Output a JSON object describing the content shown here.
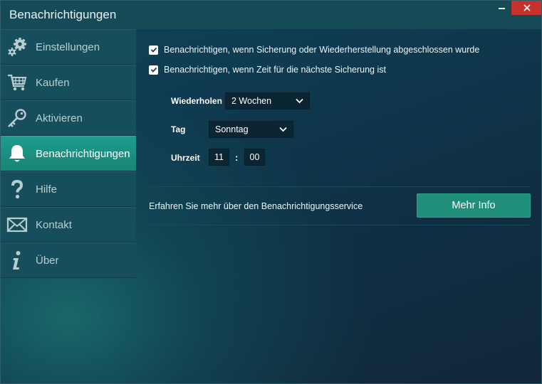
{
  "window": {
    "title": "Benachrichtigungen"
  },
  "titlebar": {
    "minimize_icon": "minimize-icon",
    "close_icon": "close-icon",
    "close_color": "#c7312b"
  },
  "sidebar": {
    "items": [
      {
        "label": "Einstellungen",
        "icon": "gears-icon"
      },
      {
        "label": "Kaufen",
        "icon": "cart-icon"
      },
      {
        "label": "Aktivieren",
        "icon": "key-icon"
      },
      {
        "label": "Benachrichtigungen",
        "icon": "bell-icon",
        "active": true
      },
      {
        "label": "Hilfe",
        "icon": "question-icon"
      },
      {
        "label": "Kontakt",
        "icon": "envelope-icon"
      },
      {
        "label": "Über",
        "icon": "info-icon"
      }
    ],
    "active_color": "#1f9b8c"
  },
  "options": {
    "notify_backup_done": {
      "label": "Benachrichtigen, wenn Sicherung oder Wiederherstellung abgeschlossen wurde",
      "checked": true
    },
    "notify_next_backup": {
      "label": "Benachrichtigen, wenn Zeit für die nächste Sicherung ist",
      "checked": true
    }
  },
  "schedule": {
    "repeat_label": "Wiederholen",
    "repeat_value": "2 Wochen",
    "day_label": "Tag",
    "day_value": "Sonntag",
    "time_label": "Uhrzeit",
    "hour": "11",
    "separator": ":",
    "minute": "00"
  },
  "info": {
    "text": "Erfahren Sie mehr über den Benachrichtigungsservice",
    "button_label": "Mehr Info",
    "button_color": "#1f8f79"
  }
}
